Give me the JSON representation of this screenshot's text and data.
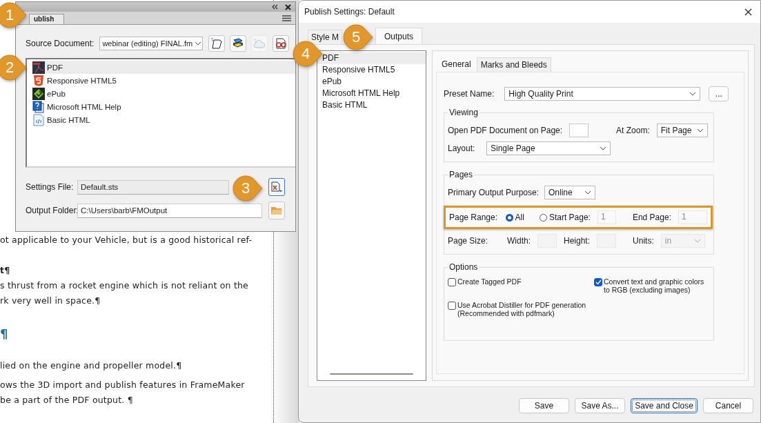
{
  "document": {
    "paragraphs": [
      {
        "kind": "body",
        "lines": [
          "ot applicable to your Vehicle, but is a good historical ref-"
        ]
      },
      {
        "kind": "heading",
        "lines": [
          "t¶"
        ]
      },
      {
        "kind": "body",
        "lines": [
          "s thrust from a rocket engine which is not reliant on the",
          "rk very well in space.¶"
        ]
      },
      {
        "kind": "title",
        "lines": [
          "¶"
        ]
      },
      {
        "kind": "body",
        "lines": [
          "lied on the engine and propeller model.¶"
        ]
      },
      {
        "kind": "body",
        "lines": [
          "ows the 3D import and publish features in FrameMaker",
          "be a part of the PDF output. ¶"
        ]
      }
    ]
  },
  "publish_panel": {
    "tab": "ublish",
    "source": {
      "label": "Source Document:",
      "value": "webinar (editing) FINAL.fm"
    },
    "toolbar": [
      {
        "kind": "page",
        "disabled": false
      },
      {
        "kind": "books",
        "disabled": false
      },
      {
        "kind": "cloud",
        "disabled": true
      },
      {
        "kind": "glasses",
        "disabled": false
      }
    ],
    "outputs": [
      {
        "label": "PDF",
        "kind": "pdf",
        "selected": true
      },
      {
        "label": "Responsive HTML5",
        "kind": "html5",
        "selected": false
      },
      {
        "label": "ePub",
        "kind": "epub",
        "selected": false
      },
      {
        "label": "Microsoft HTML Help",
        "kind": "chm",
        "selected": false
      },
      {
        "label": "Basic HTML",
        "kind": "html",
        "selected": false
      }
    ],
    "settings": {
      "label": "Settings File:",
      "value": "Default.sts"
    },
    "output_folder": {
      "label": "Output Folder:",
      "value": "C:\\Users\\barb\\FMOutput"
    }
  },
  "dialog": {
    "title": "Publish Settings: Default",
    "tabs": [
      {
        "label": "Style M",
        "selected": false
      },
      {
        "label": "Outputs",
        "selected": true
      }
    ],
    "outputs": [
      {
        "label": "PDF",
        "selected": true
      },
      {
        "label": "Responsive HTML5",
        "selected": false
      },
      {
        "label": "ePub",
        "selected": false
      },
      {
        "label": "Microsoft HTML Help",
        "selected": false
      },
      {
        "label": "Basic HTML",
        "selected": false
      }
    ],
    "inner_tabs": [
      {
        "label": "General",
        "selected": true
      },
      {
        "label": "Marks and Bleeds",
        "selected": false
      }
    ],
    "preset": {
      "label": "Preset Name:",
      "value": "High Quality Print",
      "more": "..."
    },
    "viewing": {
      "title": "Viewing",
      "open_label": "Open PDF Document on Page:",
      "zoom_label": "At Zoom:",
      "zoom_value": "Fit Page",
      "layout_label": "Layout:",
      "layout_value": "Single Page"
    },
    "pages": {
      "title": "Pages",
      "purpose_label": "Primary Output Purpose:",
      "purpose_value": "Online",
      "range_label": "Page Range:",
      "range_highlighted": true,
      "range_options": [
        {
          "label": "All",
          "selected": true
        },
        {
          "label": "Start Page:",
          "selected": false
        }
      ],
      "start_value": "1",
      "end_label": "End Page:",
      "end_value": "1",
      "size_label": "Page Size:",
      "width_label": "Width:",
      "height_label": "Height:",
      "units_label": "Units:",
      "units_value": "in",
      "size_disabled": true
    },
    "options": {
      "title": "Options",
      "checks": [
        {
          "label": "Create Tagged PDF",
          "checked": false
        },
        {
          "label": "Convert text and graphic colors\nto RGB (excluding images)",
          "checked": true
        },
        {
          "label": "Use Acrobat Distiller for PDF generation\n(Recommended with pdfmark)",
          "checked": false
        }
      ]
    },
    "buttons": [
      {
        "label": "Save",
        "default": false
      },
      {
        "label": "Save As...",
        "default": false
      },
      {
        "label": "Save and Close",
        "default": true
      },
      {
        "label": "Cancel",
        "default": false
      }
    ]
  },
  "callouts": [
    {
      "number": "1"
    },
    {
      "number": "2"
    },
    {
      "number": "3"
    },
    {
      "number": "4"
    },
    {
      "number": "5"
    }
  ]
}
